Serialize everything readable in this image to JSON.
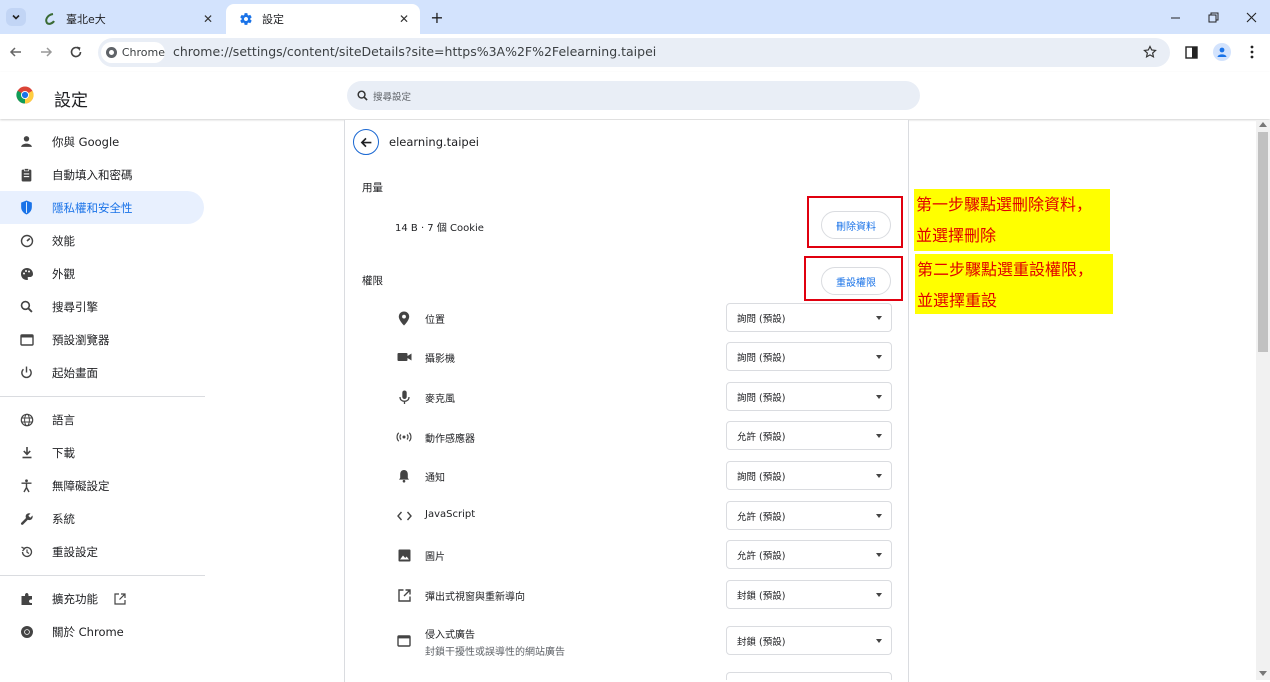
{
  "browser": {
    "tabs": [
      {
        "title": "臺北e大",
        "icon": "e-logo-icon"
      },
      {
        "title": "設定",
        "icon": "gear-icon"
      }
    ],
    "chip_label": "Chrome",
    "url": "chrome://settings/content/siteDetails?site=https%3A%2F%2Felearning.taipei"
  },
  "settings": {
    "title": "設定",
    "search_placeholder": "搜尋設定"
  },
  "sidebar": {
    "items": [
      {
        "label": "你與 Google",
        "icon": "person-icon"
      },
      {
        "label": "自動填入和密碼",
        "icon": "clipboard-icon"
      },
      {
        "label": "隱私權和安全性",
        "icon": "shield-icon"
      },
      {
        "label": "效能",
        "icon": "speedometer-icon"
      },
      {
        "label": "外觀",
        "icon": "palette-icon"
      },
      {
        "label": "搜尋引擎",
        "icon": "search-icon"
      },
      {
        "label": "預設瀏覽器",
        "icon": "browser-icon"
      },
      {
        "label": "起始畫面",
        "icon": "power-icon"
      },
      {
        "label": "語言",
        "icon": "globe-icon"
      },
      {
        "label": "下載",
        "icon": "download-icon"
      },
      {
        "label": "無障礙設定",
        "icon": "accessibility-icon"
      },
      {
        "label": "系統",
        "icon": "wrench-icon"
      },
      {
        "label": "重設設定",
        "icon": "reset-icon"
      },
      {
        "label": "擴充功能",
        "icon": "puzzle-icon"
      },
      {
        "label": "關於 Chrome",
        "icon": "chrome-icon"
      }
    ],
    "active_index": 2
  },
  "site": {
    "name": "elearning.taipei",
    "usage_heading": "用量",
    "usage_value": "14 B · 7 個 Cookie",
    "delete_button": "刪除資料",
    "permissions_heading": "權限",
    "reset_button": "重設權限",
    "permissions": [
      {
        "label": "位置",
        "value": "詢問 (預設)",
        "icon": "location-pin-icon"
      },
      {
        "label": "攝影機",
        "value": "詢問 (預設)",
        "icon": "camera-icon"
      },
      {
        "label": "麥克風",
        "value": "詢問 (預設)",
        "icon": "microphone-icon"
      },
      {
        "label": "動作感應器",
        "value": "允許 (預設)",
        "icon": "sensor-icon"
      },
      {
        "label": "通知",
        "value": "詢問 (預設)",
        "icon": "bell-icon"
      },
      {
        "label": "JavaScript",
        "value": "允許 (預設)",
        "icon": "code-icon"
      },
      {
        "label": "圖片",
        "value": "允許 (預設)",
        "icon": "image-icon"
      },
      {
        "label": "彈出式視窗與重新導向",
        "value": "封鎖 (預設)",
        "icon": "external-link-icon"
      },
      {
        "label": "侵入式廣告",
        "sublabel": "封鎖干擾性或誤導性的網站廣告",
        "value": "封鎖 (預設)",
        "icon": "ad-window-icon"
      }
    ]
  },
  "annotations": {
    "step1_line1": "第一步驟點選刪除資料，",
    "step1_line2": "並選擇刪除",
    "step2_line1": "第二步驟點選重設權限，",
    "step2_line2": "並選擇重設",
    "highlight_color": "#ffff00",
    "text_color": "#e00000",
    "box_color": "#e0000f"
  },
  "colors": {
    "accent": "#1a73e8",
    "tabstrip": "#d3e3fd"
  }
}
